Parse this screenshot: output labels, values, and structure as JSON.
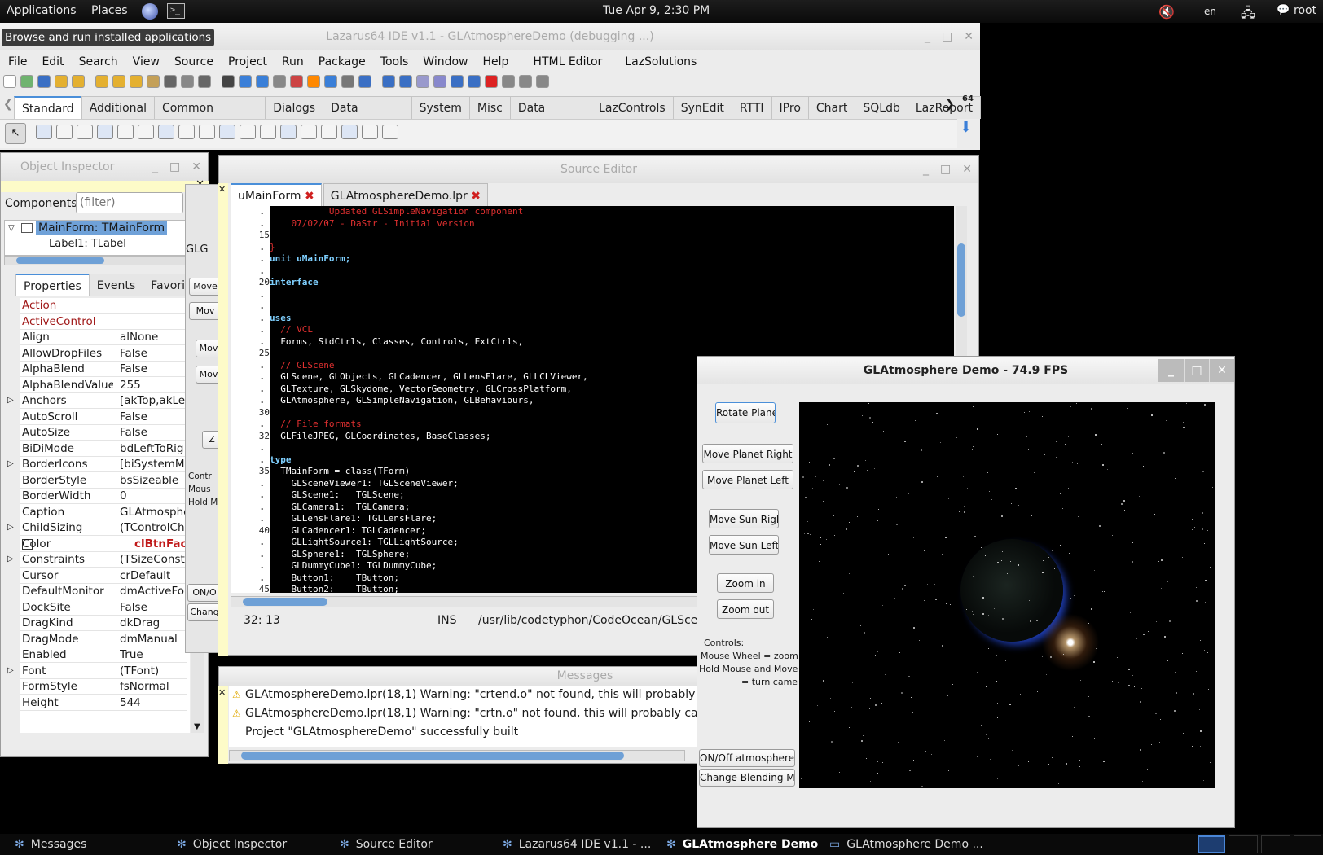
{
  "top_panel": {
    "applications": "Applications",
    "places": "Places",
    "clock": "Tue Apr  9,  2:30 PM",
    "lang": "en",
    "user": "root",
    "tooltip": "Browse and run installed applications"
  },
  "ide": {
    "title": "Lazarus64 IDE v1.1 - GLAtmosphereDemo (debugging ...)",
    "menu": [
      "File",
      "Edit",
      "Search",
      "View",
      "Source",
      "Project",
      "Run",
      "Package",
      "Tools",
      "Window",
      "Help",
      "HTML Editor",
      "LazSolutions"
    ],
    "palette_tabs": [
      "Standard",
      "Additional",
      "Common Controls",
      "Dialogs",
      "Data Controls",
      "System",
      "Misc",
      "Data Access",
      "LazControls",
      "SynEdit",
      "RTTI",
      "IPro",
      "Chart",
      "SQLdb",
      "LazReport"
    ],
    "palette_label": "64"
  },
  "object_inspector": {
    "title": "Object Inspector",
    "components_label": "Components",
    "filter_placeholder": "(filter)",
    "tree": [
      "MainForm: TMainForm",
      "Label1: TLabel"
    ],
    "tabs": [
      "Properties",
      "Events",
      "Favorites"
    ],
    "properties": [
      {
        "name": "Action",
        "value": "",
        "highlight": true
      },
      {
        "name": "ActiveControl",
        "value": "",
        "highlight": true
      },
      {
        "name": "Align",
        "value": "alNone"
      },
      {
        "name": "AllowDropFiles",
        "value": "False"
      },
      {
        "name": "AlphaBlend",
        "value": "False"
      },
      {
        "name": "AlphaBlendValue",
        "value": "255"
      },
      {
        "name": "Anchors",
        "value": "[akTop,akLef",
        "expand": true
      },
      {
        "name": "AutoScroll",
        "value": "False"
      },
      {
        "name": "AutoSize",
        "value": "False"
      },
      {
        "name": "BiDiMode",
        "value": "bdLeftToRig"
      },
      {
        "name": "BorderIcons",
        "value": "[biSystemMe",
        "expand": true
      },
      {
        "name": "BorderStyle",
        "value": "bsSizeable"
      },
      {
        "name": "BorderWidth",
        "value": "0"
      },
      {
        "name": "Caption",
        "value": "GLAtmosphe"
      },
      {
        "name": "ChildSizing",
        "value": "(TControlCh",
        "expand": true
      },
      {
        "name": "Color",
        "value": "clBtnFac",
        "color": true
      },
      {
        "name": "Constraints",
        "value": "(TSizeConst",
        "expand": true
      },
      {
        "name": "Cursor",
        "value": "crDefault"
      },
      {
        "name": "DefaultMonitor",
        "value": "dmActiveFor"
      },
      {
        "name": "DockSite",
        "value": "False"
      },
      {
        "name": "DragKind",
        "value": "dkDrag"
      },
      {
        "name": "DragMode",
        "value": "dmManual"
      },
      {
        "name": "Enabled",
        "value": "True"
      },
      {
        "name": "Font",
        "value": "(TFont)",
        "expand": true
      },
      {
        "name": "FormStyle",
        "value": "fsNormal"
      },
      {
        "name": "Height",
        "value": "544"
      }
    ]
  },
  "form_designer": {
    "label": "GLG",
    "buttons": [
      "Move",
      "Mov",
      "Mov",
      "Mov",
      "Z"
    ],
    "labels": [
      "Contr",
      "Mous",
      "Hold M"
    ],
    "bottom_buttons": [
      "ON/O",
      "Chang"
    ]
  },
  "source_editor": {
    "title": "Source Editor",
    "tabs": [
      "uMainForm",
      "GLAtmosphereDemo.lpr"
    ],
    "status_pos": "32: 13",
    "status_mode": "INS",
    "status_file": "/usr/lib/codetyphon/CodeOcean/GLScene",
    "code_lines": [
      {
        "n": "",
        "t": "           Updated GLSimpleNavigation component",
        "c": "red"
      },
      {
        "n": "",
        "t": "    07/02/07 - DaStr - Initial version",
        "c": "red"
      },
      {
        "n": "15",
        "t": "",
        "c": "white"
      },
      {
        "n": "",
        "t": "}",
        "c": "red"
      },
      {
        "n": "",
        "t": "unit uMainForm;",
        "c": "kw"
      },
      {
        "n": "",
        "t": "",
        "c": "white"
      },
      {
        "n": "20",
        "t": "interface",
        "c": "kw"
      },
      {
        "n": "",
        "t": "",
        "c": "white"
      },
      {
        "n": "",
        "t": "",
        "c": "white"
      },
      {
        "n": "",
        "t": "uses",
        "c": "kw"
      },
      {
        "n": "",
        "t": "  // VCL",
        "c": "red"
      },
      {
        "n": "",
        "t": "  Forms, StdCtrls, Classes, Controls, ExtCtrls,",
        "c": "white"
      },
      {
        "n": "25",
        "t": "",
        "c": "white"
      },
      {
        "n": "",
        "t": "  // GLScene",
        "c": "red"
      },
      {
        "n": "",
        "t": "  GLScene, GLObjects, GLCadencer, GLLensFlare, GLLCLViewer,",
        "c": "white"
      },
      {
        "n": "",
        "t": "  GLTexture, GLSkydome, VectorGeometry, GLCrossPlatform,",
        "c": "white"
      },
      {
        "n": "",
        "t": "  GLAtmosphere, GLSimpleNavigation, GLBehaviours,",
        "c": "white"
      },
      {
        "n": "30",
        "t": "",
        "c": "white"
      },
      {
        "n": "",
        "t": "  // File formats",
        "c": "red"
      },
      {
        "n": "32",
        "t": "  GLFileJPEG, GLCoordinates, BaseClasses;",
        "c": "white"
      },
      {
        "n": "",
        "t": "",
        "c": "white"
      },
      {
        "n": "",
        "t": "type",
        "c": "kw"
      },
      {
        "n": "35",
        "t": "  TMainForm = class(TForm)",
        "c": "white"
      },
      {
        "n": "",
        "t": "    GLSceneViewer1: TGLSceneViewer;",
        "c": "white"
      },
      {
        "n": "",
        "t": "    GLScene1:   TGLScene;",
        "c": "white"
      },
      {
        "n": "",
        "t": "    GLCamera1:  TGLCamera;",
        "c": "white"
      },
      {
        "n": "",
        "t": "    GLLensFlare1: TGLLensFlare;",
        "c": "white"
      },
      {
        "n": "40",
        "t": "    GLCadencer1: TGLCadencer;",
        "c": "white"
      },
      {
        "n": "",
        "t": "    GLLightSource1: TGLLightSource;",
        "c": "white"
      },
      {
        "n": "",
        "t": "    GLSphere1:  TGLSphere;",
        "c": "white"
      },
      {
        "n": "",
        "t": "    GLDummyCube1: TGLDummyCube;",
        "c": "white"
      },
      {
        "n": "",
        "t": "    Button1:    TButton;",
        "c": "white"
      },
      {
        "n": "45",
        "t": "    Button2:    TButton;",
        "c": "white"
      }
    ]
  },
  "messages": {
    "title": "Messages",
    "items": [
      {
        "icon": "warning",
        "text": "GLAtmosphereDemo.lpr(18,1) Warning: \"crtend.o\" not found, this will probably cau"
      },
      {
        "icon": "warning",
        "text": "GLAtmosphereDemo.lpr(18,1) Warning: \"crtn.o\" not found, this will probably cause"
      },
      {
        "icon": "",
        "text": "Project \"GLAtmosphereDemo\" successfully built"
      }
    ]
  },
  "demo": {
    "title": "GLAtmosphere Demo - 74.9 FPS",
    "buttons": {
      "rotate": "Rotate Plane",
      "planet_right": "Move Planet Right",
      "planet_left": "Move Planet Left",
      "sun_right": "Move Sun Righ",
      "sun_left": "Move Sun Left",
      "zoom_in": "Zoom in",
      "zoom_out": "Zoom out",
      "atmosphere": "ON/Off atmosphere",
      "blending": "Change Blending Mo"
    },
    "controls_text": [
      "Controls:",
      "Mouse Wheel = zoom",
      "Hold Mouse and Move",
      "= turn came"
    ]
  },
  "taskbar": [
    "Messages",
    "Object Inspector",
    "Source Editor",
    "Lazarus64 IDE v1.1 - ...",
    "GLAtmosphere Demo",
    "GLAtmosphere Demo ..."
  ]
}
